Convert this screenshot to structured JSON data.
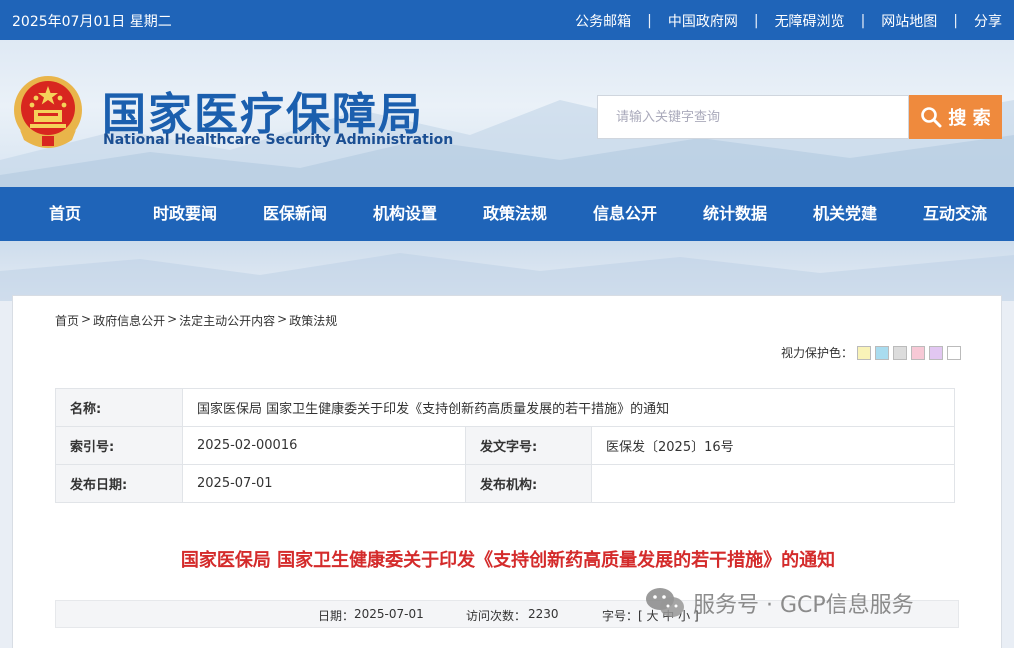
{
  "topbar": {
    "date": "2025年07月01日 星期二",
    "links": [
      "公务邮箱",
      "中国政府网",
      "无障碍浏览",
      "网站地图",
      "分享"
    ],
    "separator": "|"
  },
  "header": {
    "site_name_cn": "国家医疗保障局",
    "site_name_en": "National Healthcare Security Administration",
    "search_placeholder": "请输入关键字查询",
    "search_button": "搜 索"
  },
  "nav": [
    "首页",
    "时政要闻",
    "医保新闻",
    "机构设置",
    "政策法规",
    "信息公开",
    "统计数据",
    "机关党建",
    "互动交流"
  ],
  "breadcrumb": [
    "首页",
    "政府信息公开",
    "法定主动公开内容",
    "政策法规"
  ],
  "breadcrumb_sep": ">",
  "eye_protect": {
    "label": "视力保护色：",
    "swatches": [
      "#f9f3b8",
      "#a9dcef",
      "#dcdcdc",
      "#f7c9d6",
      "#e2c7f2",
      "#ffffff"
    ]
  },
  "meta": {
    "name_label": "名称:",
    "name_value": "国家医保局 国家卫生健康委关于印发《支持创新药高质量发展的若干措施》的通知",
    "index_label": "索引号:",
    "index_value": "2025-02-00016",
    "docno_label": "发文字号:",
    "docno_value": "医保发〔2025〕16号",
    "date_label": "发布日期:",
    "date_value": "2025-07-01",
    "org_label": "发布机构:",
    "org_value": ""
  },
  "doc_title": "国家医保局 国家卫生健康委关于印发《支持创新药高质量发展的若干措施》的通知",
  "infobar": {
    "date_label": "日期：",
    "date_value": "2025-07-01",
    "visits_label": "访问次数：",
    "visits_value": "2230",
    "font_label": "字号：",
    "font_sizes": "[ 大 中 小 ]"
  },
  "watermark": "服务号 · GCP信息服务"
}
